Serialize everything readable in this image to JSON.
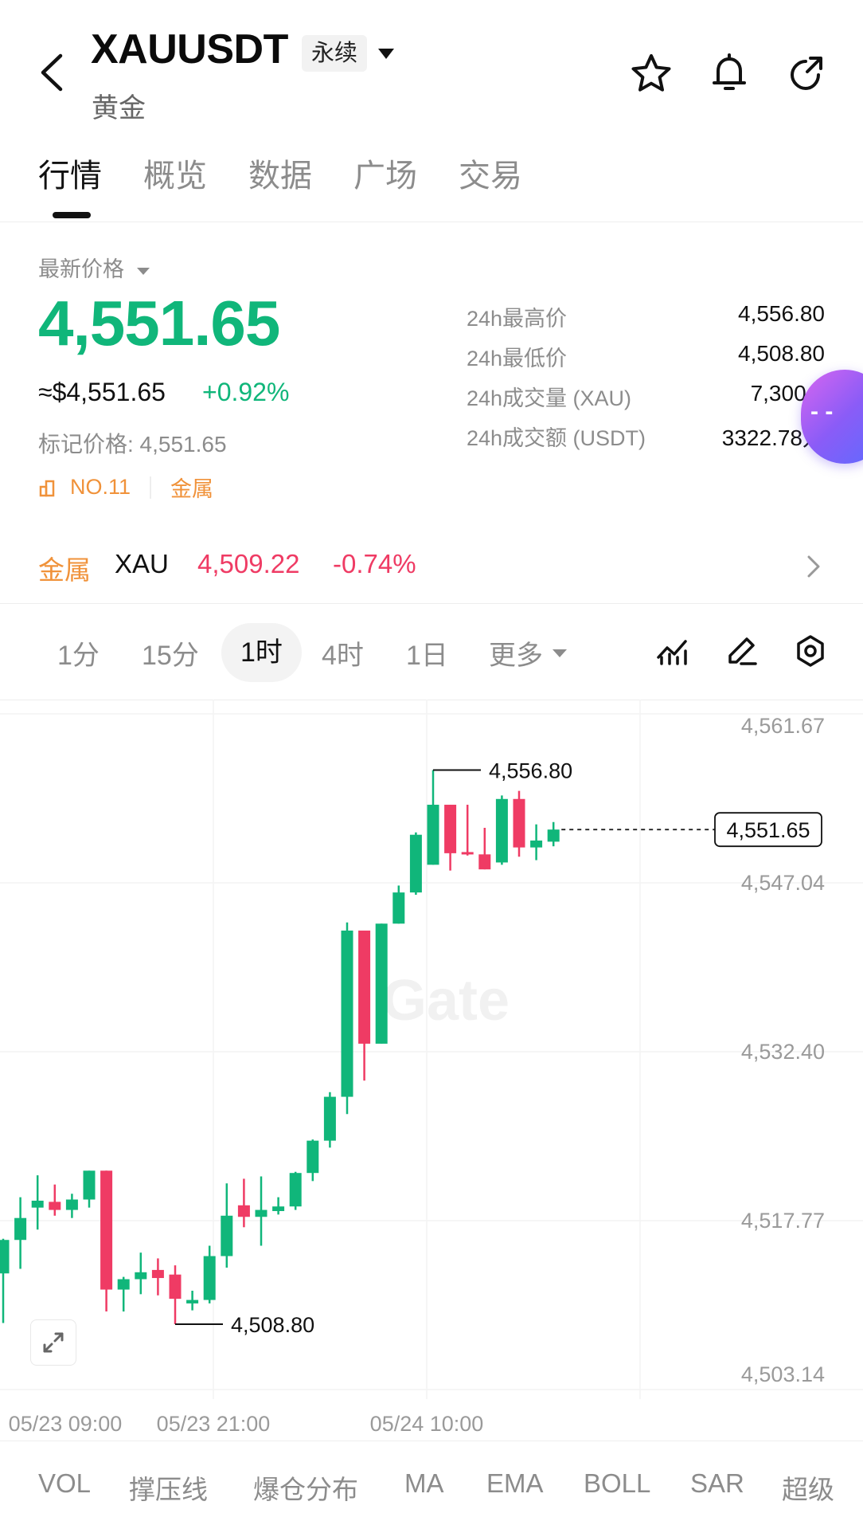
{
  "header": {
    "symbol": "XAUUSDT",
    "contract_badge": "永续",
    "subtitle": "黄金",
    "icons": [
      "back-arrow-icon",
      "dropdown-caret-icon",
      "star-icon",
      "bell-icon",
      "share-icon"
    ]
  },
  "tabs": [
    {
      "label": "行情",
      "active": true
    },
    {
      "label": "概览",
      "active": false
    },
    {
      "label": "数据",
      "active": false
    },
    {
      "label": "广场",
      "active": false
    },
    {
      "label": "交易",
      "active": false
    }
  ],
  "ticker": {
    "price_label": "最新价格",
    "last_price": "4,551.65",
    "usd_equiv": "≈$4,551.65",
    "change_pct": "+0.92%",
    "mark_price": "标记价格: 4,551.65",
    "rank": "NO.11",
    "category": "金属",
    "up_color": "#10b67a",
    "down_color": "#ef3b64"
  },
  "stats": [
    {
      "label": "24h最高价",
      "value": "4,556.80"
    },
    {
      "label": "24h最低价",
      "value": "4,508.80"
    },
    {
      "label": "24h成交量 (XAU)",
      "value": "7,300.1"
    },
    {
      "label": "24h成交额 (USDT)",
      "value": "3322.78万"
    }
  ],
  "floating_button": {
    "text": "- -"
  },
  "metal_row": {
    "category": "金属",
    "symbol": "XAU",
    "price": "4,509.22",
    "change": "-0.74%"
  },
  "intervals": [
    {
      "label": "1分",
      "active": false
    },
    {
      "label": "15分",
      "active": false
    },
    {
      "label": "1时",
      "active": true
    },
    {
      "label": "4时",
      "active": false
    },
    {
      "label": "1日",
      "active": false
    },
    {
      "label": "更多",
      "active": false
    }
  ],
  "chart_data": {
    "type": "candlestick",
    "interval": "1时",
    "ylim": [
      4503.14,
      4561.67
    ],
    "y_ticks": [
      "4,561.67",
      "4,547.04",
      "4,532.40",
      "4,517.77",
      "4,503.14"
    ],
    "x_ticks": [
      "05/23 09:00",
      "05/23 21:00",
      "05/24 10:00"
    ],
    "watermark": "Gate",
    "current_price_label": "4,551.65",
    "current_price": 4551.65,
    "high_annotation": {
      "label": "4,556.80",
      "value": 4556.8
    },
    "low_annotation": {
      "label": "4,508.80",
      "value": 4508.8
    },
    "candles": [
      {
        "o": 4513.2,
        "h": 4516.2,
        "l": 4508.9,
        "c": 4516.1
      },
      {
        "o": 4516.1,
        "h": 4519.8,
        "l": 4513.6,
        "c": 4518.0
      },
      {
        "o": 4518.9,
        "h": 4521.7,
        "l": 4517.0,
        "c": 4519.5
      },
      {
        "o": 4519.4,
        "h": 4520.9,
        "l": 4518.2,
        "c": 4518.7
      },
      {
        "o": 4518.7,
        "h": 4520.1,
        "l": 4518.0,
        "c": 4519.6
      },
      {
        "o": 4519.6,
        "h": 4522.1,
        "l": 4518.9,
        "c": 4522.1
      },
      {
        "o": 4522.1,
        "h": 4522.1,
        "l": 4509.9,
        "c": 4511.8
      },
      {
        "o": 4511.8,
        "h": 4512.9,
        "l": 4509.9,
        "c": 4512.7
      },
      {
        "o": 4512.7,
        "h": 4515.0,
        "l": 4511.4,
        "c": 4513.3
      },
      {
        "o": 4513.5,
        "h": 4514.5,
        "l": 4511.3,
        "c": 4512.8
      },
      {
        "o": 4513.1,
        "h": 4513.9,
        "l": 4508.8,
        "c": 4511.0
      },
      {
        "o": 4510.6,
        "h": 4511.7,
        "l": 4510.0,
        "c": 4510.9
      },
      {
        "o": 4510.9,
        "h": 4515.6,
        "l": 4510.6,
        "c": 4514.7
      },
      {
        "o": 4514.7,
        "h": 4521.0,
        "l": 4513.7,
        "c": 4518.2
      },
      {
        "o": 4519.1,
        "h": 4521.4,
        "l": 4517.2,
        "c": 4518.1
      },
      {
        "o": 4518.1,
        "h": 4521.6,
        "l": 4515.6,
        "c": 4518.7
      },
      {
        "o": 4518.6,
        "h": 4519.8,
        "l": 4518.3,
        "c": 4519.0
      },
      {
        "o": 4519.0,
        "h": 4522.0,
        "l": 4518.7,
        "c": 4521.9
      },
      {
        "o": 4521.9,
        "h": 4524.8,
        "l": 4521.2,
        "c": 4524.7
      },
      {
        "o": 4524.7,
        "h": 4528.9,
        "l": 4524.1,
        "c": 4528.5
      },
      {
        "o": 4528.5,
        "h": 4543.6,
        "l": 4527.0,
        "c": 4542.9
      },
      {
        "o": 4542.9,
        "h": 4542.9,
        "l": 4529.9,
        "c": 4533.1
      },
      {
        "o": 4533.1,
        "h": 4543.5,
        "l": 4533.1,
        "c": 4543.5
      },
      {
        "o": 4543.5,
        "h": 4546.8,
        "l": 4543.5,
        "c": 4546.2
      },
      {
        "o": 4546.2,
        "h": 4551.4,
        "l": 4546.0,
        "c": 4551.2
      },
      {
        "o": 4548.6,
        "h": 4556.8,
        "l": 4548.6,
        "c": 4553.8
      },
      {
        "o": 4553.8,
        "h": 4553.8,
        "l": 4548.1,
        "c": 4549.6
      },
      {
        "o": 4549.7,
        "h": 4553.8,
        "l": 4549.4,
        "c": 4549.5
      },
      {
        "o": 4549.5,
        "h": 4551.8,
        "l": 4548.2,
        "c": 4548.2
      },
      {
        "o": 4548.8,
        "h": 4554.6,
        "l": 4548.6,
        "c": 4554.3
      },
      {
        "o": 4554.3,
        "h": 4555.0,
        "l": 4549.3,
        "c": 4550.1
      },
      {
        "o": 4550.1,
        "h": 4552.1,
        "l": 4549.0,
        "c": 4550.7
      },
      {
        "o": 4550.6,
        "h": 4552.3,
        "l": 4550.2,
        "c": 4551.65
      }
    ]
  },
  "indicators": [
    {
      "label": "VOL"
    },
    {
      "label": "撑压线"
    },
    {
      "label": "爆仓分布"
    },
    {
      "label": "MA"
    },
    {
      "label": "EMA"
    },
    {
      "label": "BOLL"
    },
    {
      "label": "SAR"
    },
    {
      "label": "超级"
    }
  ]
}
